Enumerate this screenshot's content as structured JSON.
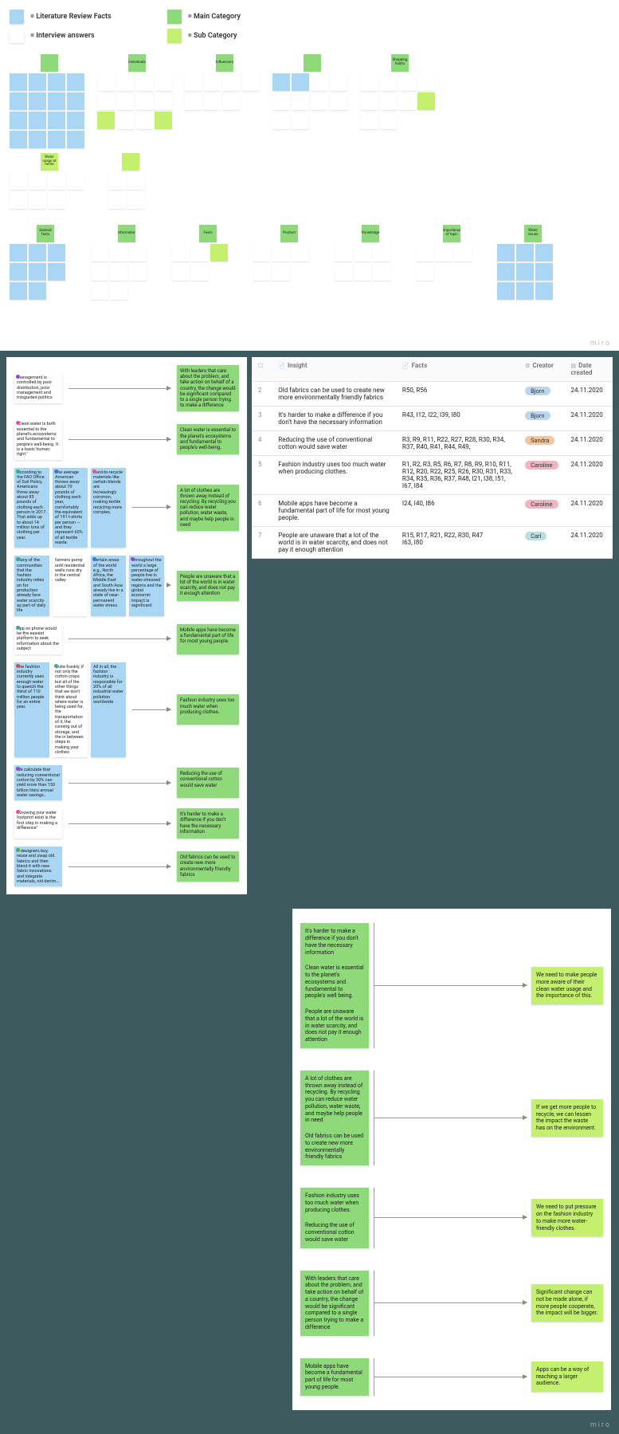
{
  "legend": {
    "blue": "= Literature Review Facts",
    "white": "= Interview answers",
    "green": "= Main Category",
    "lime": "= Sub Category"
  },
  "miro": "miro",
  "top_clusters_row1": [
    {
      "head_color": "n-green",
      "head": "",
      "notes": [
        "n-blue",
        "n-blue",
        "n-blue",
        "n-blue",
        "n-blue",
        "n-blue",
        "n-blue",
        "n-blue",
        "n-blue",
        "n-blue",
        "n-blue",
        "n-blue",
        "n-blue",
        "n-blue",
        "n-blue",
        "n-blue"
      ]
    },
    {
      "head_color": "n-green",
      "head": "Individuals",
      "notes": [
        "n-white",
        "n-white",
        "n-white",
        "n-white",
        "n-white",
        "n-white",
        "n-white",
        "n-white",
        "n-lime",
        "n-white",
        "n-white",
        "n-lime"
      ]
    },
    {
      "head_color": "n-green",
      "head": "Influencers",
      "notes": [
        "n-white",
        "n-white",
        "n-white",
        "n-white",
        "n-white",
        "n-white",
        "n-white"
      ]
    },
    {
      "head_color": "n-green",
      "head": "",
      "notes": [
        "n-blue",
        "n-blue",
        "n-white",
        "n-white",
        "n-white",
        "n-white",
        "n-white",
        "n-white",
        "n-white",
        "n-white"
      ]
    },
    {
      "head_color": "n-green",
      "head": "Shopping habits",
      "notes": [
        "n-white",
        "n-white",
        "n-white",
        "n-white",
        "n-white",
        "n-white",
        "n-white",
        "n-lime",
        "n-white",
        "n-white"
      ]
    }
  ],
  "top_sub_left": {
    "head": "Water usage at home",
    "notes": [
      "n-white",
      "n-white",
      "n-white",
      "n-white",
      "n-white",
      "n-white",
      "n-white"
    ]
  },
  "top_sub_right": {
    "head": "",
    "notes": [
      "n-white",
      "n-white",
      "n-white",
      "n-white"
    ]
  },
  "top_clusters_row2": [
    {
      "head_color": "n-green",
      "head": "General facts",
      "notes": [
        "n-blue",
        "n-blue",
        "n-blue",
        "n-blue",
        "n-blue",
        "n-blue",
        "n-blue",
        "n-blue"
      ]
    },
    {
      "head_color": "n-green",
      "head": "Information",
      "notes": [
        "n-white",
        "n-white",
        "n-white",
        "n-white",
        "n-white",
        "n-white",
        "n-white",
        "n-white"
      ]
    },
    {
      "head_color": "n-green",
      "head": "Fears",
      "notes": [
        "n-white",
        "n-white",
        "n-lime",
        "n-white",
        "n-white"
      ]
    },
    {
      "head_color": "n-green",
      "head": "Product",
      "notes": [
        "n-white",
        "n-white",
        "n-white",
        "n-white",
        "n-white"
      ]
    },
    {
      "head_color": "n-green",
      "head": "Knowledge",
      "notes": [
        "n-white",
        "n-white",
        "n-white",
        "n-white",
        "n-white",
        "n-white"
      ]
    },
    {
      "head_color": "n-green",
      "head": "Importance of topic",
      "notes": [
        "n-white",
        "n-white",
        "n-white",
        "n-white"
      ]
    },
    {
      "head_color": "n-green",
      "head": "Water issues",
      "notes": [
        "n-blue",
        "n-blue",
        "n-blue",
        "n-blue",
        "n-blue",
        "n-blue",
        "n-blue",
        "n-blue",
        "n-blue"
      ]
    }
  ],
  "map": [
    {
      "left": [
        {
          "c": "n-white",
          "t": "management is controlled by poor distribution, poor management and misguided politics",
          "d": "d-purple"
        }
      ],
      "right": {
        "c": "n-green",
        "t": "With leaders that care about the problem, and take action on behalf of a country, the change would be significant compared to a single person trying to make a difference"
      }
    },
    {
      "left": [
        {
          "c": "n-white",
          "t": "\"Clean water is both essential to the planet's ecosystems and fundamental to people's well-being. It is a basic human right.\"",
          "d": "d-pink"
        }
      ],
      "right": {
        "c": "n-green",
        "t": "Clean water is essential to the planet's ecosystems and fundamental to people's well-being."
      }
    },
    {
      "left": [
        {
          "c": "n-blue",
          "t": "According to the FAO Office of Soil Policy, Americans throw away about 85 pounds of clothing each person in 2017. That adds up to about 14 million tons of clothing per year.",
          "d": "d-teal"
        },
        {
          "c": "n-blue",
          "t": "The average American throws away about 70 pounds of clothing each year, comfortably the equivalent of 191 t-shirts per person — and they represent 60% of all textile waste.",
          "d": "d-blue"
        },
        {
          "c": "n-blue",
          "t": "Hard-to-recycle materials like certain blends are increasingly common, making textile recycling more complex.",
          "d": "d-pink"
        }
      ],
      "right": {
        "c": "n-green",
        "t": "A lot of clothes are thrown away instead of recycling. By recycling you can reduce water pollution, water waste, and maybe help people in need"
      }
    },
    {
      "left": [
        {
          "c": "n-blue",
          "t": "Many of the communities that the fashion industry relies on for production already face water scarcity as part of daily life",
          "d": "d-teal"
        },
        {
          "c": "n-white",
          "t": "farmers pump until residential wells runs dry in the central valley"
        },
        {
          "c": "n-blue",
          "t": "Certain areas of the world e.g., North Africa, the Middle East and South Asia already live in a state of near-permanent water stress.",
          "d": "d-blue"
        },
        {
          "c": "n-blue",
          "t": "Throughout the world a large percentage of people live in water-stressed regions and the global economic impact is significant.",
          "d": "d-purple"
        }
      ],
      "right": {
        "c": "n-green",
        "t": "People are unaware that a lot of the world is in water scarcity, and does not pay it enough attention"
      }
    },
    {
      "left": [
        {
          "c": "n-white",
          "t": "App on phone would be the easiest platform to seek information about the subject",
          "d": "d-teal"
        }
      ],
      "right": {
        "c": "n-green",
        "t": "Mobile apps have become a fundamental part of life for most young people."
      }
    },
    {
      "left": [
        {
          "c": "n-blue",
          "t": "The fashion industry currently uses enough water to quench the thirst of 110 million people for an entire year.",
          "d": "d-red"
        },
        {
          "c": "n-white",
          "t": "Quite frankly, if not only the cotton crops but all of the other things that we don't think about where water is being used for, the transportation of it, the running out of storage, and the in between steps in making your clothes",
          "d": "d-teal"
        },
        {
          "c": "n-blue",
          "t": "All in all, the fashion industry is responsible for 20% of all industrial water pollution worldwide."
        }
      ],
      "right": {
        "c": "n-green",
        "t": "Fashion industry uses too much water when producing clothes."
      }
    },
    {
      "left": [
        {
          "c": "n-blue",
          "t": "We calculate that reducing conventional cotton by 30% can yield more than 150 billion liters annual water savings…",
          "d": "d-purple"
        }
      ],
      "right": {
        "c": "n-green",
        "t": "Reducing the use of conventional cotton would save water"
      }
    },
    {
      "left": [
        {
          "c": "n-white",
          "t": "\"Knowing your water footprint exist is the first step in making a difference\"",
          "d": "d-pink"
        }
      ],
      "right": {
        "c": "n-green",
        "t": "It's harder to make a difference if you don't have the necessary information"
      }
    },
    {
      "left": [
        {
          "c": "n-blue",
          "t": "If designers buy, reuse and swap old fabrics and then blend it with new fabric innovations and integrate materials, old denim…",
          "d": "d-green"
        }
      ],
      "right": {
        "c": "n-green",
        "t": "Old fabrics can be used to create new more environmentally friendly fabrics"
      }
    }
  ],
  "table": {
    "headers": [
      "",
      "Insight",
      "Facts",
      "Creator",
      "Date created"
    ],
    "rows": [
      {
        "n": "2",
        "insight": "Old fabrics can be used to create new more environmentally friendly fabrics",
        "facts": "R50, R56",
        "creator": "Bjorn",
        "pill": "pill-blue",
        "date": "24.11.2020"
      },
      {
        "n": "3",
        "insight": "It's harder to make a difference if you don't have the necessary information",
        "facts": "R43, I12, I22, I39, I80",
        "creator": "Bjorn",
        "pill": "pill-blue",
        "date": "24.11.2020"
      },
      {
        "n": "4",
        "insight": "Reducing the use of conventional cotton would save water",
        "facts": "R3, R9, R11, R22, R27, R28, R30, R34, R37, R40, R41, R44, R49,",
        "creator": "Sandra",
        "pill": "pill-orange",
        "date": "24.11.2020"
      },
      {
        "n": "5",
        "insight": "Fashion industry uses too much water when producing clothes.",
        "facts": "R1, R2, R3, R5, R6, R7, R8, R9, R10, R11, R12, R20, R22, R25, R26, R30, R31, R33, R34, R35, R36, R37, R48, I21, I38, I51, I67, I84",
        "creator": "Caroline",
        "pill": "pill-pink",
        "date": "24.11.2020"
      },
      {
        "n": "6",
        "insight": "Mobile apps have become a fundamental part of life for most young people.",
        "facts": "I24, I40, I86",
        "creator": "Caroline",
        "pill": "pill-pink",
        "date": "24.11.2020"
      },
      {
        "n": "7",
        "insight": "People are unaware that a lot of the world is in water scarcity, and does not pay it enough attention",
        "facts": "R15, R17, R21, R22, R30, R47\nI63, I80",
        "creator": "Carl",
        "pill": "pill-teal",
        "date": "24.11.2020"
      }
    ]
  },
  "lower_rows": [
    {
      "stack": [
        {
          "c": "n-green",
          "t": "It's harder to make a difference if you don't have the necessary information"
        },
        {
          "c": "n-green",
          "t": "Clean water is essential to the planet's ecosystems and fundamental to people's well being."
        },
        {
          "c": "n-green",
          "t": "People are unaware that a lot of the world is in water scarcity, and does not pay it enough attention"
        }
      ],
      "right": {
        "c": "n-lime",
        "t": "We need to make people more aware of their clean water usage and the importance of this."
      }
    },
    {
      "stack": [
        {
          "c": "n-green",
          "t": "A lot of clothes are thrown away instead of recycling. By recycling you can reduce water pollution, water waste, and maybe help people in need"
        },
        {
          "c": "n-green",
          "t": "Old fabrics can be used to create new more environmentally friendly fabrics"
        }
      ],
      "right": {
        "c": "n-lime",
        "t": "If we get more people to recycle, we can lessen the impact the waste has on the environment."
      }
    },
    {
      "stack": [
        {
          "c": "n-green",
          "t": "Fashion industry uses too much water when producing clothes."
        },
        {
          "c": "n-green",
          "t": "Reducing the use of conventional cotton would save water"
        }
      ],
      "right": {
        "c": "n-lime",
        "t": "We need to put pressure on the fashion industry to make more water-friendly clothes."
      }
    },
    {
      "stack": [
        {
          "c": "n-green",
          "t": "With leaders that care about the problem, and take action on behalf of a country, the change would be significant compared to a single person trying to make a difference"
        }
      ],
      "right": {
        "c": "n-lime",
        "t": "Significant change can not be made alone, if more people cooperate, the impact will be bigger."
      }
    },
    {
      "stack": [
        {
          "c": "n-green",
          "t": "Mobile apps have become a fundamental part of life for most young people."
        }
      ],
      "right": {
        "c": "n-lime",
        "t": "Apps can be a way of reaching a larger audience."
      }
    }
  ]
}
